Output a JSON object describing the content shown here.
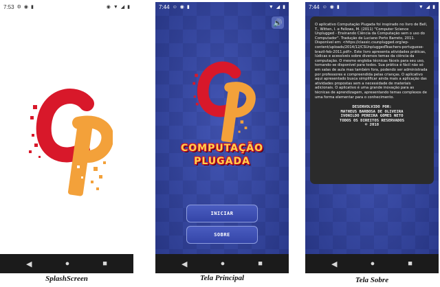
{
  "screens": [
    {
      "caption": "SplashScreen",
      "status": {
        "time": "7:53"
      }
    },
    {
      "caption": "Tela Principal",
      "status": {
        "time": "7:44"
      },
      "title_line1": "COMPUTAÇÃO",
      "title_line2": "PLUGADA",
      "buttons": {
        "start": "INICIAR",
        "about": "SOBRE"
      }
    },
    {
      "caption": "Tela Sobre",
      "status": {
        "time": "7:44"
      },
      "about_text": "O aplicativo Computação Plugada foi inspirado no livro de Bell, T., Witten, I. e Fellows, M. (2011) \"Computer Science Unplugged - Ensinando Ciência da Computação sem o uso do Computador\". Tradução de Luciano Porto Barreto, 2011. Disponível em: <https://classic.csunplugged.org/wp-content/uploads/2014/12/CSUnpluggedTeachers-portuguese-brazil-feb-2011.pdf>. Este livro apresenta atividades práticas, lúdicas e acessíveis sobre diversos temas da ciência da computação. O mesmo engloba técnicas fáceis para seu uso, tornando-se disponível para todos. Sua prática é fácil não só em salas de aula mas também fora, podendo ser administrada por professores e compreendida pelas crianças. O aplicativo aqui apresentado busca simplificar ainda mais a aplicação das atividades propostas sem a necessidade de materiais adicionais. O aplicativo é uma grande inovação para as técnicas de aprendizagem, apresentando temas complexos de uma forma elementar para o conhecimento.",
      "credits": [
        "DESENVOLVIDO POR:",
        "MATHEUS BARBOSA DE OLIVEIRA",
        "IVONILDO PEREIRA GOMES NETO",
        "TODOS OS DIREITOS RESERVADOS",
        "© 2018"
      ]
    }
  ],
  "icons": {
    "back": "back-triangle-icon",
    "home": "home-circle-icon",
    "recent": "recents-square-icon",
    "sound": "speaker-icon"
  },
  "colors": {
    "logo_red": "#d8182a",
    "logo_orange": "#f3a13a",
    "background_blue": "#3648a4",
    "title_yellow": "#ffd34a",
    "card_dark": "#2b2b2b",
    "navbar": "#1b1b1b"
  }
}
